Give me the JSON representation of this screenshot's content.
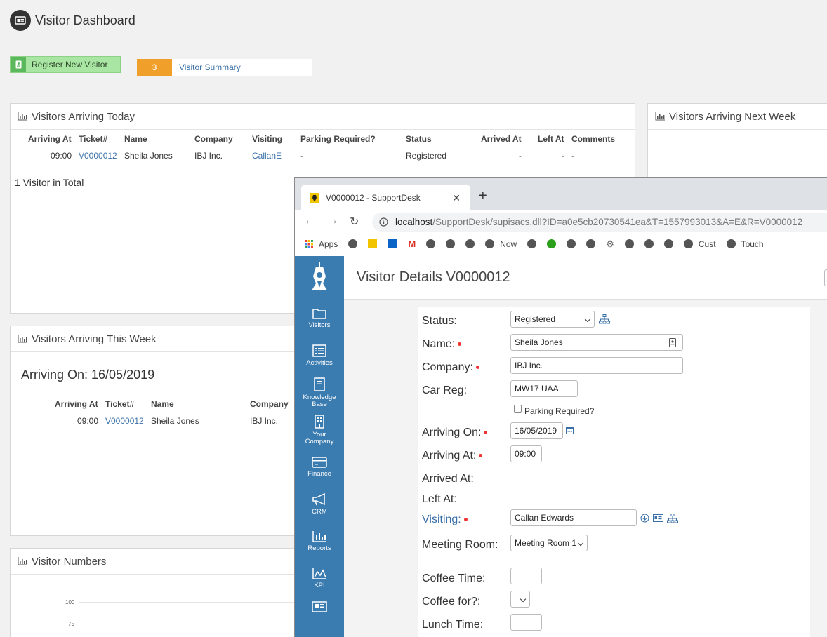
{
  "dashboard": {
    "title": "Visitor Dashboard",
    "register_label": "Register New Visitor",
    "summary_count": "3",
    "summary_label": "Visitor Summary"
  },
  "today": {
    "title": "Visitors Arriving Today",
    "headers": [
      "Arriving At",
      "Ticket#",
      "Name",
      "Company",
      "Visiting",
      "Parking Required?",
      "Status",
      "Arrived At",
      "Left At",
      "Comments"
    ],
    "row": [
      "09:00",
      "V0000012",
      "Sheila Jones",
      "IBJ Inc.",
      "CallanE",
      "-",
      "Registered",
      "-",
      "-",
      "-"
    ],
    "total": "1 Visitor in Total"
  },
  "next_week": {
    "title": "Visitors Arriving Next Week"
  },
  "this_week": {
    "title": "Visitors Arriving This Week",
    "arriving_on": "Arriving On: 16/05/2019",
    "headers": [
      "Arriving At",
      "Ticket#",
      "Name",
      "Company"
    ],
    "row": [
      "09:00",
      "V0000012",
      "Sheila Jones",
      "IBJ Inc."
    ]
  },
  "numbers": {
    "title": "Visitor Numbers",
    "ticks": [
      "100",
      "75"
    ]
  },
  "browser": {
    "tab_title": "V0000012 - SupportDesk",
    "url_host": "localhost",
    "url_path": "/SupportDesk/supisacs.dll?ID=a0e5cb20730541ea&T=1557993013&A=E&R=V0000012",
    "bookmarks": {
      "apps": "Apps",
      "now": "Now",
      "cust": "Cust",
      "touch": "Touch"
    }
  },
  "sidebar": {
    "items": [
      "Visitors",
      "Activities",
      "Knowledge Base",
      "Your Company",
      "Finance",
      "CRM",
      "Reports",
      "KPI"
    ]
  },
  "details": {
    "title": "Visitor Details V0000012",
    "labels": {
      "status": "Status:",
      "name": "Name:",
      "company": "Company:",
      "car_reg": "Car Reg:",
      "parking": "Parking Required?",
      "arriving_on": "Arriving On:",
      "arriving_at": "Arriving At:",
      "arrived_at": "Arrived At:",
      "left_at": "Left At:",
      "visiting": "Visiting:",
      "meeting_room": "Meeting Room:",
      "coffee_time": "Coffee Time:",
      "coffee_for": "Coffee for?:",
      "lunch_time": "Lunch Time:"
    },
    "values": {
      "status": "Registered",
      "name": "Sheila Jones",
      "company": "IBJ Inc.",
      "car_reg": "MW17 UAA",
      "arriving_on": "16/05/2019",
      "arriving_at": "09:00",
      "visiting": "Callan Edwards",
      "meeting_room": "Meeting Room 1"
    }
  }
}
